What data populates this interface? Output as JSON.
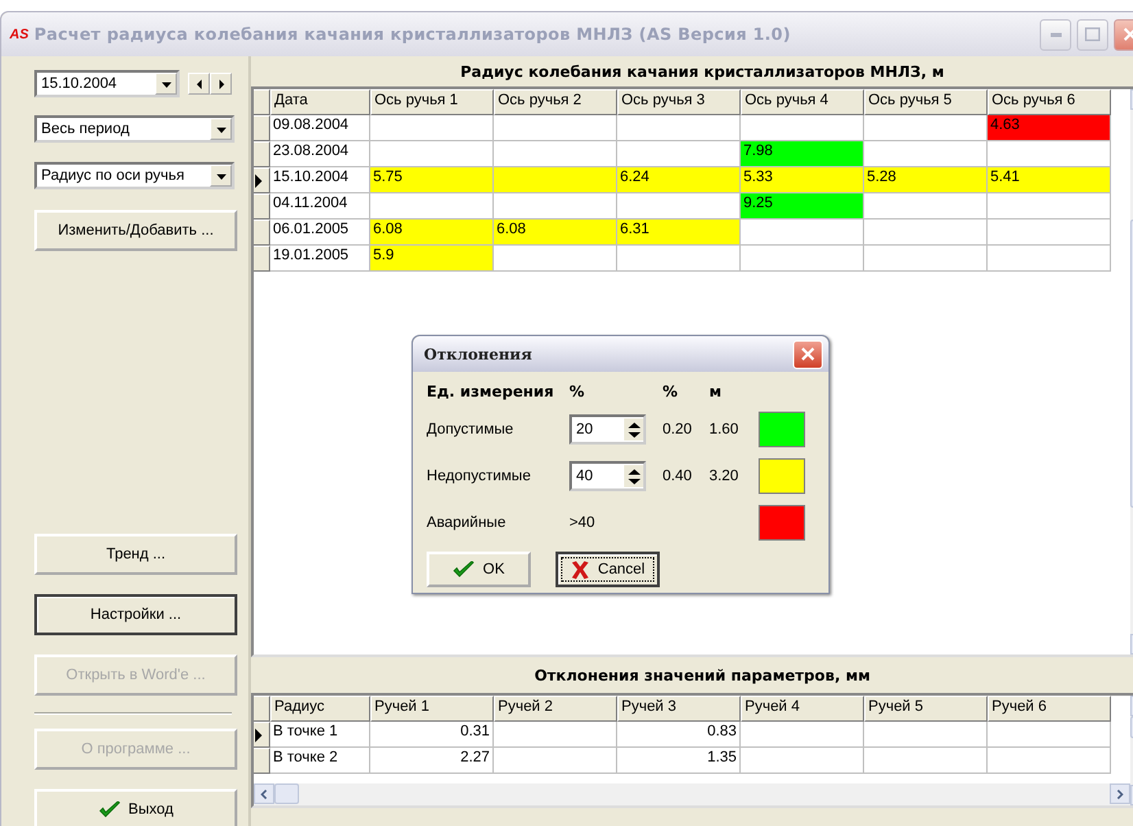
{
  "window": {
    "logo": "AS",
    "title": "Расчет радиуса колебания качания кристаллизаторов МНЛЗ (AS Версия 1.0)"
  },
  "sidebar": {
    "date_field": {
      "value": "15.10.2004"
    },
    "period_select": {
      "value": "Весь период"
    },
    "mode_select": {
      "value": "Радиус по оси ручья"
    },
    "edit_button": {
      "label": "Изменить/Добавить ...",
      "disabled": false,
      "focused": false
    },
    "action_buttons": [
      {
        "label": "Тренд ...",
        "disabled": false,
        "focused": false
      },
      {
        "label": "Настройки ...",
        "disabled": false,
        "focused": true
      },
      {
        "label": "Открыть в Word'e ...",
        "disabled": true,
        "focused": false
      }
    ],
    "about_button": {
      "label": "О программе ...",
      "disabled": true,
      "focused": false
    },
    "exit_button": {
      "label": "Выход",
      "disabled": false,
      "focused": false
    }
  },
  "radius_table": {
    "title": "Радиус колебания качания кристаллизаторов МНЛЗ, м",
    "columns": [
      "Дата",
      "Ось ручья 1",
      "Ось ручья 2",
      "Ось ручья 3",
      "Ось ручья 4",
      "Ось ручья 5",
      "Ось ручья 6"
    ],
    "rows": [
      {
        "date": "09.08.2004",
        "selected": false,
        "col_6": {
          "text": "4.63",
          "color": "#ff0000"
        }
      },
      {
        "date": "23.08.2004",
        "selected": false,
        "col_4": {
          "text": "7.98",
          "color": "#00ff00"
        }
      },
      {
        "date": "15.10.2004",
        "selected": true,
        "col_1": {
          "text": "5.75",
          "color": "#ffff00"
        },
        "col_2": {
          "color": "#ffff00"
        },
        "col_3": {
          "text": "6.24",
          "color": "#ffff00"
        },
        "col_4": {
          "text": "5.33",
          "color": "#ffff00"
        },
        "col_5": {
          "text": "5.28",
          "color": "#ffff00"
        },
        "col_6": {
          "text": "5.41",
          "color": "#ffff00"
        }
      },
      {
        "date": "04.11.2004",
        "selected": false,
        "col_4": {
          "text": "9.25",
          "color": "#00ff00"
        }
      },
      {
        "date": "06.01.2005",
        "selected": false,
        "col_1": {
          "text": "6.08",
          "color": "#ffff00"
        },
        "col_2": {
          "text": "6.08",
          "color": "#ffff00"
        },
        "col_3": {
          "text": "6.31",
          "color": "#ffff00"
        }
      },
      {
        "date": "19.01.2005",
        "selected": false,
        "col_1": {
          "text": "5.9",
          "color": "#ffff00"
        }
      }
    ]
  },
  "deviation_table": {
    "title": "Отклонения значений параметров, мм",
    "columns": [
      "Радиус",
      "Ручей 1",
      "Ручей 2",
      "Ручей 3",
      "Ручей 4",
      "Ручей 5",
      "Ручей 6"
    ],
    "rows": [
      {
        "label": "В точке 1",
        "selected": true,
        "col_1": "0.31",
        "col_3": "0.83"
      },
      {
        "label": "В точке 2",
        "selected": false,
        "col_1": "2.27",
        "col_3": "1.35"
      }
    ]
  },
  "dialog": {
    "title": "Отклонения",
    "headers": [
      "Ед. измерения",
      "%",
      "%",
      "м"
    ],
    "rows": [
      {
        "kind": "spin",
        "label": "Допустимые",
        "value": "20",
        "fraction": "0.20",
        "meters": "1.60",
        "color": "#00ff00"
      },
      {
        "kind": "spin",
        "label": "Недопустимые",
        "value": "40",
        "fraction": "0.40",
        "meters": "3.20",
        "color": "#ffff00"
      },
      {
        "kind": "limit",
        "label": "Аварийные",
        "limit": ">40",
        "color": "#ff0000"
      }
    ],
    "buttons": [
      {
        "label": "OK",
        "kind": "ok",
        "focused": false
      },
      {
        "label": "Cancel",
        "kind": "cancel",
        "focused": true
      }
    ]
  }
}
